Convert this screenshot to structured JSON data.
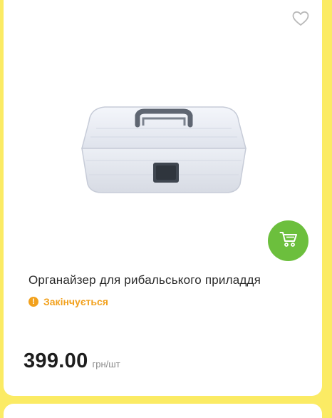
{
  "product": {
    "title": "Органайзер для рибальського приладдя",
    "status": "Закінчується",
    "price": "399.00",
    "unit": "грн/шт"
  },
  "icons": {
    "wishlist": "heart-outline-icon",
    "cart": "cart-icon",
    "status": "exclamation-circle-icon"
  },
  "colors": {
    "background": "#fbeb64",
    "cart_button": "#6cbf3d",
    "status": "#f2a11d"
  }
}
